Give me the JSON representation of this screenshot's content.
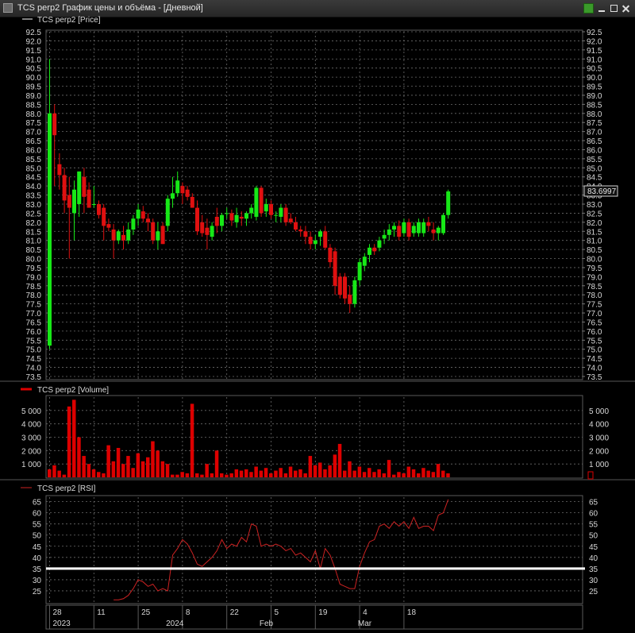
{
  "window": {
    "title": "TCS perp2 График цены и объёма - [Дневной]"
  },
  "legend": {
    "price": "TCS perp2 [Price]",
    "volume": "TCS perp2 [Volume]",
    "rsi": "TCS perp2 [RSI]"
  },
  "colors": {
    "up": "#17e817",
    "down": "#e01010",
    "volume": "#dd0000",
    "rsi_line": "#cc2222",
    "level_line": "#ffffff",
    "grid": "#6b6b6b"
  },
  "chart_data": [
    {
      "type": "candlestick",
      "panel": "price",
      "ylim": [
        73.5,
        92.5
      ],
      "y_ticks": [
        "92.5",
        "92.0",
        "91.5",
        "91.0",
        "90.5",
        "90.0",
        "89.5",
        "89.0",
        "88.5",
        "88.0",
        "87.5",
        "87.0",
        "86.5",
        "86.0",
        "85.5",
        "85.0",
        "84.5",
        "84.0",
        "83.5",
        "83.0",
        "82.5",
        "82.0",
        "81.5",
        "81.0",
        "80.5",
        "80.0",
        "79.5",
        "79.0",
        "78.5",
        "78.0",
        "77.5",
        "77.0",
        "76.5",
        "76.0",
        "75.5",
        "75.0",
        "74.5",
        "74.0",
        "73.5"
      ],
      "last_price_label": "83.6997",
      "candles": [
        {
          "o": 75.2,
          "h": 91.0,
          "l": 75.0,
          "c": 88.0
        },
        {
          "o": 88.0,
          "h": 88.5,
          "l": 84.0,
          "c": 86.8
        },
        {
          "o": 85.2,
          "h": 85.8,
          "l": 83.8,
          "c": 84.6
        },
        {
          "o": 84.6,
          "h": 85.0,
          "l": 82.5,
          "c": 83.2
        },
        {
          "o": 83.5,
          "h": 84.5,
          "l": 80.0,
          "c": 82.8
        },
        {
          "o": 82.5,
          "h": 84.3,
          "l": 81.0,
          "c": 83.8
        },
        {
          "o": 83.0,
          "h": 84.8,
          "l": 82.3,
          "c": 84.8
        },
        {
          "o": 84.5,
          "h": 85.0,
          "l": 82.5,
          "c": 83.4
        },
        {
          "o": 83.8,
          "h": 84.2,
          "l": 82.8,
          "c": 82.8
        },
        {
          "o": 83.0,
          "h": 84.0,
          "l": 82.8,
          "c": 83.0
        },
        {
          "o": 83.0,
          "h": 83.2,
          "l": 82.2,
          "c": 82.4
        },
        {
          "o": 82.8,
          "h": 83.0,
          "l": 81.0,
          "c": 81.8
        },
        {
          "o": 81.9,
          "h": 82.2,
          "l": 81.5,
          "c": 81.7
        },
        {
          "o": 81.6,
          "h": 81.9,
          "l": 80.0,
          "c": 81.0
        },
        {
          "o": 81.0,
          "h": 81.6,
          "l": 80.8,
          "c": 81.5
        },
        {
          "o": 81.3,
          "h": 81.8,
          "l": 80.5,
          "c": 81.0
        },
        {
          "o": 81.0,
          "h": 82.0,
          "l": 80.8,
          "c": 81.6
        },
        {
          "o": 81.6,
          "h": 82.4,
          "l": 81.3,
          "c": 82.2
        },
        {
          "o": 82.2,
          "h": 83.0,
          "l": 81.8,
          "c": 82.7
        },
        {
          "o": 82.6,
          "h": 82.9,
          "l": 82.0,
          "c": 82.2
        },
        {
          "o": 82.2,
          "h": 82.5,
          "l": 81.5,
          "c": 82.0
        },
        {
          "o": 82.0,
          "h": 82.2,
          "l": 80.8,
          "c": 81.0
        },
        {
          "o": 81.0,
          "h": 82.0,
          "l": 80.5,
          "c": 81.5
        },
        {
          "o": 81.8,
          "h": 82.0,
          "l": 80.8,
          "c": 80.8
        },
        {
          "o": 81.8,
          "h": 83.5,
          "l": 81.5,
          "c": 83.3
        },
        {
          "o": 83.3,
          "h": 84.5,
          "l": 82.8,
          "c": 83.6
        },
        {
          "o": 83.6,
          "h": 84.8,
          "l": 83.4,
          "c": 84.3
        },
        {
          "o": 84.0,
          "h": 84.2,
          "l": 83.0,
          "c": 83.6
        },
        {
          "o": 83.8,
          "h": 84.0,
          "l": 83.2,
          "c": 83.4
        },
        {
          "o": 83.4,
          "h": 83.6,
          "l": 82.8,
          "c": 82.8
        },
        {
          "o": 82.8,
          "h": 83.2,
          "l": 81.3,
          "c": 81.5
        },
        {
          "o": 82.0,
          "h": 82.4,
          "l": 81.2,
          "c": 81.4
        },
        {
          "o": 81.7,
          "h": 82.2,
          "l": 80.5,
          "c": 81.3
        },
        {
          "o": 81.2,
          "h": 82.0,
          "l": 81.0,
          "c": 81.8
        },
        {
          "o": 82.3,
          "h": 82.8,
          "l": 81.4,
          "c": 81.8
        },
        {
          "o": 81.8,
          "h": 82.5,
          "l": 81.5,
          "c": 82.4
        },
        {
          "o": 82.5,
          "h": 82.8,
          "l": 82.2,
          "c": 82.5
        },
        {
          "o": 82.5,
          "h": 82.7,
          "l": 81.8,
          "c": 82.1
        },
        {
          "o": 82.0,
          "h": 82.8,
          "l": 81.7,
          "c": 82.4
        },
        {
          "o": 82.3,
          "h": 82.6,
          "l": 81.8,
          "c": 82.2
        },
        {
          "o": 82.2,
          "h": 82.6,
          "l": 81.8,
          "c": 82.5
        },
        {
          "o": 82.5,
          "h": 83.0,
          "l": 82.2,
          "c": 82.8
        },
        {
          "o": 82.3,
          "h": 84.0,
          "l": 82.1,
          "c": 83.9
        },
        {
          "o": 83.9,
          "h": 84.0,
          "l": 82.3,
          "c": 82.5
        },
        {
          "o": 82.6,
          "h": 83.3,
          "l": 82.3,
          "c": 83.0
        },
        {
          "o": 83.0,
          "h": 83.2,
          "l": 82.2,
          "c": 82.4
        },
        {
          "o": 82.4,
          "h": 82.6,
          "l": 82.0,
          "c": 82.4
        },
        {
          "o": 82.3,
          "h": 83.0,
          "l": 82.0,
          "c": 82.8
        },
        {
          "o": 82.8,
          "h": 83.0,
          "l": 81.8,
          "c": 82.0
        },
        {
          "o": 82.2,
          "h": 82.5,
          "l": 81.9,
          "c": 82.0
        },
        {
          "o": 82.0,
          "h": 82.3,
          "l": 81.5,
          "c": 81.6
        },
        {
          "o": 81.6,
          "h": 81.8,
          "l": 81.2,
          "c": 81.5
        },
        {
          "o": 81.5,
          "h": 81.8,
          "l": 80.8,
          "c": 81.2
        },
        {
          "o": 81.2,
          "h": 81.5,
          "l": 80.5,
          "c": 80.8
        },
        {
          "o": 80.8,
          "h": 81.3,
          "l": 80.5,
          "c": 81.0
        },
        {
          "o": 81.2,
          "h": 81.6,
          "l": 80.7,
          "c": 81.5
        },
        {
          "o": 81.5,
          "h": 81.8,
          "l": 80.5,
          "c": 80.6
        },
        {
          "o": 80.6,
          "h": 80.8,
          "l": 79.5,
          "c": 79.8
        },
        {
          "o": 80.4,
          "h": 80.6,
          "l": 78.0,
          "c": 78.5
        },
        {
          "o": 79.0,
          "h": 79.2,
          "l": 77.8,
          "c": 78.0
        },
        {
          "o": 79.0,
          "h": 79.2,
          "l": 77.5,
          "c": 77.8
        },
        {
          "o": 78.0,
          "h": 78.5,
          "l": 77.0,
          "c": 77.5
        },
        {
          "o": 77.5,
          "h": 79.0,
          "l": 77.3,
          "c": 78.8
        },
        {
          "o": 78.8,
          "h": 80.0,
          "l": 78.5,
          "c": 79.8
        },
        {
          "o": 79.6,
          "h": 80.3,
          "l": 79.3,
          "c": 80.1
        },
        {
          "o": 80.2,
          "h": 80.8,
          "l": 79.8,
          "c": 80.6
        },
        {
          "o": 80.6,
          "h": 80.8,
          "l": 80.2,
          "c": 80.4
        },
        {
          "o": 80.6,
          "h": 81.2,
          "l": 80.4,
          "c": 81.0
        },
        {
          "o": 81.1,
          "h": 81.6,
          "l": 80.8,
          "c": 81.3
        },
        {
          "o": 81.3,
          "h": 81.9,
          "l": 81.0,
          "c": 81.6
        },
        {
          "o": 81.6,
          "h": 82.0,
          "l": 81.2,
          "c": 81.8
        },
        {
          "o": 81.8,
          "h": 82.1,
          "l": 81.0,
          "c": 81.2
        },
        {
          "o": 81.4,
          "h": 82.2,
          "l": 81.2,
          "c": 82.0
        },
        {
          "o": 82.0,
          "h": 82.2,
          "l": 81.0,
          "c": 81.2
        },
        {
          "o": 81.4,
          "h": 82.0,
          "l": 81.2,
          "c": 81.8
        },
        {
          "o": 81.4,
          "h": 82.2,
          "l": 81.2,
          "c": 82.0
        },
        {
          "o": 81.4,
          "h": 82.2,
          "l": 81.2,
          "c": 82.0
        },
        {
          "o": 82.0,
          "h": 82.3,
          "l": 81.5,
          "c": 81.8
        },
        {
          "o": 81.6,
          "h": 82.0,
          "l": 81.0,
          "c": 81.4
        },
        {
          "o": 81.4,
          "h": 81.8,
          "l": 81.0,
          "c": 81.7
        },
        {
          "o": 81.4,
          "h": 82.5,
          "l": 81.3,
          "c": 82.4
        },
        {
          "o": 82.4,
          "h": 83.8,
          "l": 82.2,
          "c": 83.7
        }
      ]
    },
    {
      "type": "bar",
      "panel": "volume",
      "ylim": [
        0,
        6000
      ],
      "y_ticks": [
        "5 000",
        "4 000",
        "3 000",
        "2 000",
        "1 000"
      ],
      "values": [
        600,
        900,
        500,
        200,
        5300,
        5800,
        3000,
        1600,
        1000,
        600,
        400,
        300,
        2400,
        1200,
        2200,
        1000,
        1600,
        700,
        1800,
        1200,
        1500,
        2700,
        2000,
        1200,
        1000,
        200,
        200,
        400,
        300,
        5500,
        300,
        200,
        1000,
        300,
        2000,
        300,
        200,
        300,
        600,
        500,
        600,
        400,
        800,
        500,
        700,
        300,
        500,
        700,
        300,
        800,
        500,
        600,
        300,
        1600,
        900,
        1100,
        600,
        900,
        1700,
        2500,
        500,
        1200,
        500,
        800,
        400,
        700,
        400,
        600,
        300,
        1300,
        200,
        400,
        300,
        800,
        600,
        300,
        700,
        500,
        400,
        1000,
        500,
        300
      ]
    },
    {
      "type": "line",
      "panel": "rsi",
      "ylim": [
        20,
        67
      ],
      "y_ticks": [
        "65",
        "60",
        "55",
        "50",
        "45",
        "40",
        "35",
        "30",
        "25"
      ],
      "level": 35,
      "values": [
        null,
        null,
        null,
        null,
        null,
        null,
        null,
        null,
        null,
        null,
        null,
        null,
        null,
        21,
        21,
        21.5,
        23,
        26,
        30,
        29,
        27,
        28,
        25,
        26,
        25,
        41,
        44,
        48,
        46,
        42,
        37,
        36,
        38,
        40,
        43,
        48,
        44,
        46,
        45,
        49,
        47,
        55,
        54,
        45,
        46,
        45,
        46,
        45,
        43,
        44,
        41,
        42,
        40,
        38,
        43,
        35,
        44,
        41,
        35,
        28,
        27,
        26,
        26,
        36,
        42,
        47,
        48,
        54,
        55,
        53,
        56,
        54,
        56,
        53,
        58,
        53,
        54,
        54,
        52,
        59,
        60,
        66
      ]
    },
    {
      "type": "x-axis",
      "tick_labels": [
        "28",
        "11",
        "25",
        "8",
        "22",
        "5",
        "19",
        "4",
        "18"
      ],
      "tick_index": [
        0,
        9,
        18,
        27,
        36,
        45,
        54,
        63,
        72
      ],
      "period_labels": [
        {
          "text": "2023",
          "index": 0
        },
        {
          "text": "2024",
          "index": 23
        },
        {
          "text": "Feb",
          "index": 42
        },
        {
          "text": "Mar",
          "index": 62
        }
      ]
    }
  ]
}
